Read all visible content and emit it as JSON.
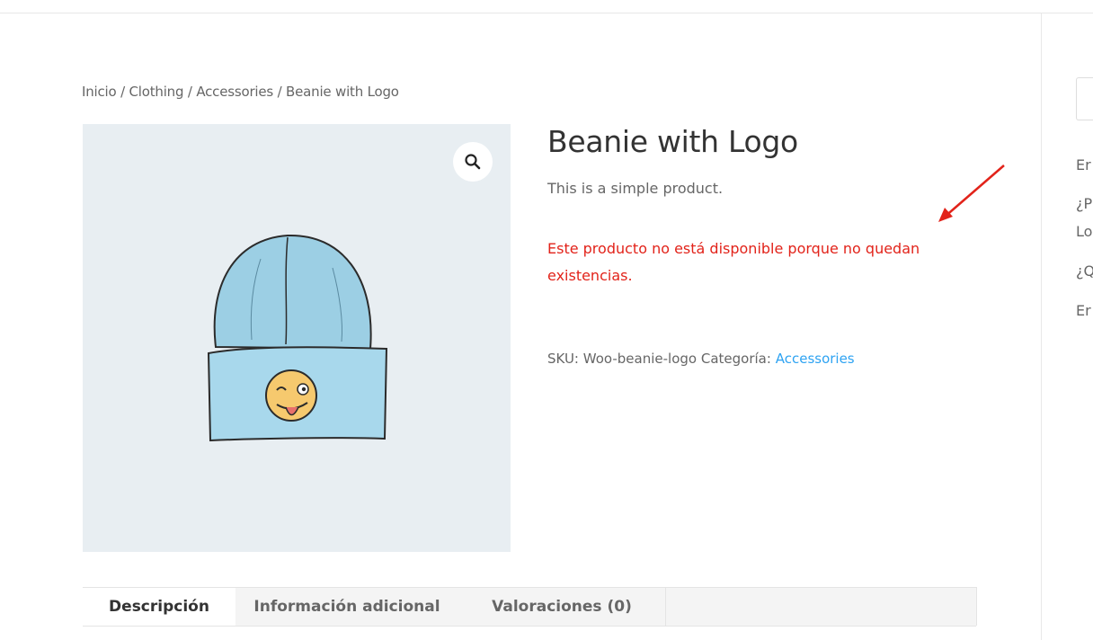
{
  "breadcrumb": {
    "home": "Inicio",
    "sep": " / ",
    "cat1": "Clothing",
    "cat2": "Accessories",
    "current": "Beanie with Logo"
  },
  "product": {
    "title": "Beanie with Logo",
    "short_description": "This is a simple product.",
    "stock_message": "Este producto no está disponible porque no quedan existencias.",
    "sku_label": "SKU:",
    "sku": "Woo-beanie-logo",
    "category_label": "Categoría:",
    "category": "Accessories",
    "image_icon": "beanie-with-winking-emoji",
    "zoom_icon": "magnifier-icon"
  },
  "tabs": [
    {
      "label": "Descripción",
      "active": true
    },
    {
      "label": "Información adicional",
      "active": false
    },
    {
      "label": "Valoraciones (0)",
      "active": false
    }
  ],
  "sidebar": {
    "line1": "Er",
    "line2": "¿P",
    "line3": "Lo",
    "line4": "¿Q",
    "line5": "Er"
  },
  "colors": {
    "accent": "#2ea3f2",
    "stock_alert": "#e2231a",
    "image_bg": "#e8eef2"
  }
}
